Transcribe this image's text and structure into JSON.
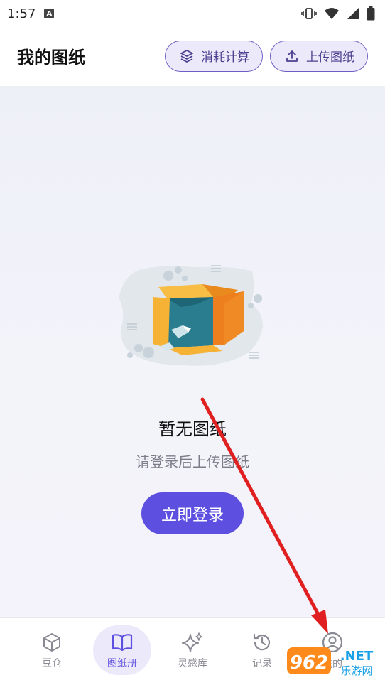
{
  "status_bar": {
    "time": "1:57",
    "a_badge": "A"
  },
  "header": {
    "title": "我的图纸",
    "buttons": [
      {
        "label": "消耗计算",
        "icon": "layers-icon"
      },
      {
        "label": "上传图纸",
        "icon": "upload-icon"
      }
    ]
  },
  "empty_state": {
    "illustration": "empty-box-illustration",
    "title": "暂无图纸",
    "subtitle": "请登录后上传图纸",
    "button_label": "立即登录"
  },
  "bottom_nav": {
    "items": [
      {
        "label": "豆仓",
        "icon": "cube-icon",
        "active": false
      },
      {
        "label": "图纸册",
        "icon": "book-icon",
        "active": true
      },
      {
        "label": "灵感库",
        "icon": "sparkle-icon",
        "active": false
      },
      {
        "label": "记录",
        "icon": "history-icon",
        "active": false
      },
      {
        "label": "我的",
        "icon": "user-icon",
        "active": false
      }
    ]
  },
  "watermark": {
    "text_962": "962",
    "text_net": ".NET",
    "text_site": "乐游网"
  },
  "colors": {
    "accent": "#5d4fe0",
    "button_bg": "#ece9fb",
    "arrow": "#e02020"
  }
}
